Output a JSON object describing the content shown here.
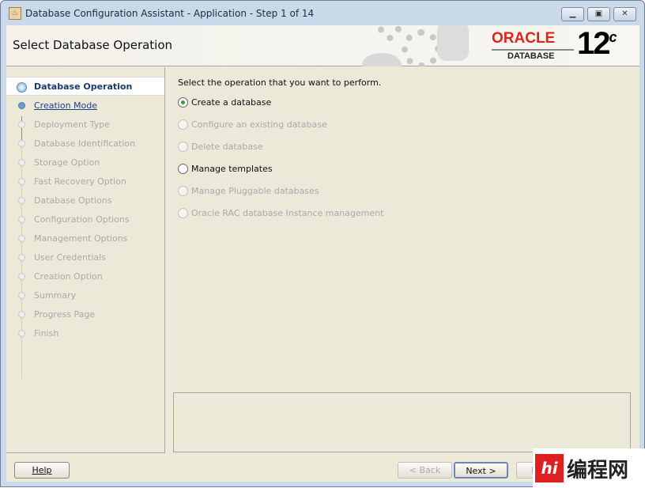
{
  "window": {
    "title": "Database Configuration Assistant - Application - Step 1 of 14",
    "controls": [
      "minimize",
      "maximize",
      "close"
    ]
  },
  "header": {
    "title": "Select Database Operation",
    "logo": {
      "brand": "ORACLE",
      "product": "DATABASE",
      "version": "12",
      "version_suffix": "c"
    }
  },
  "sidebar": {
    "steps": [
      {
        "label": "Database Operation",
        "state": "active"
      },
      {
        "label": "Creation Mode",
        "state": "link"
      },
      {
        "label": "Deployment Type",
        "state": "disabled"
      },
      {
        "label": "Database Identification",
        "state": "disabled"
      },
      {
        "label": "Storage Option",
        "state": "disabled"
      },
      {
        "label": "Fast Recovery Option",
        "state": "disabled"
      },
      {
        "label": "Database Options",
        "state": "disabled"
      },
      {
        "label": "Configuration Options",
        "state": "disabled"
      },
      {
        "label": "Management Options",
        "state": "disabled"
      },
      {
        "label": "User Credentials",
        "state": "disabled"
      },
      {
        "label": "Creation Option",
        "state": "disabled"
      },
      {
        "label": "Summary",
        "state": "disabled"
      },
      {
        "label": "Progress Page",
        "state": "disabled"
      },
      {
        "label": "Finish",
        "state": "disabled"
      }
    ]
  },
  "main": {
    "instruction": "Select the operation that you want to perform.",
    "options": [
      {
        "label": "Create a database",
        "selected": true,
        "enabled": true
      },
      {
        "label": "Configure an existing database",
        "selected": false,
        "enabled": false
      },
      {
        "label": "Delete database",
        "selected": false,
        "enabled": false
      },
      {
        "label": "Manage templates",
        "selected": false,
        "enabled": true
      },
      {
        "label": "Manage Pluggable databases",
        "selected": false,
        "enabled": false
      },
      {
        "label": "Oracle RAC database Instance management",
        "selected": false,
        "enabled": false
      }
    ]
  },
  "footer": {
    "help": "Help",
    "back": "< Back",
    "next": "Next >",
    "finish": "F"
  },
  "watermark": {
    "text": "编程网",
    "badge": "hi"
  }
}
